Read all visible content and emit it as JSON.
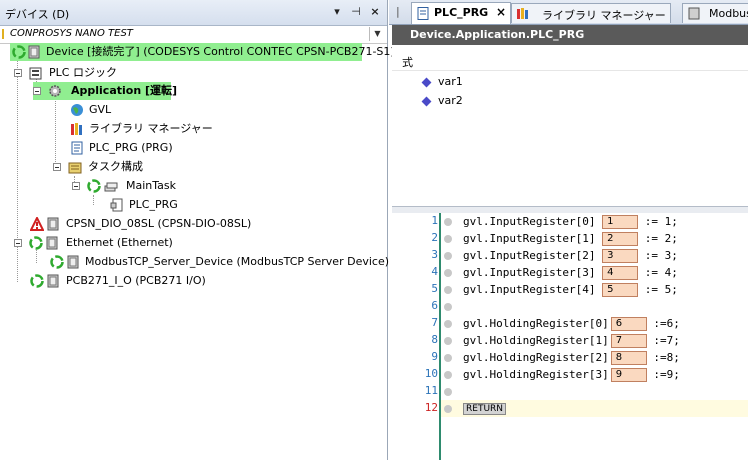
{
  "left_panel": {
    "title": "デバイス (D)",
    "header_buttons": {
      "dropdown": "▾",
      "pin": "⊣",
      "close": "×"
    },
    "project_selector": "CONPROSYS NANO TEST",
    "tree": [
      {
        "label": "Device [接続完了] (CODESYS Control CONTEC CPSN-PCB271-S1)",
        "highlight": true,
        "icon": "device-running-icon"
      },
      {
        "label": "PLC ロジック",
        "icon": "plc-logic-icon"
      },
      {
        "label": "Application [運転]",
        "highlight": true,
        "bold": true,
        "icon": "application-gear-icon"
      },
      {
        "label": "GVL",
        "icon": "globe-icon"
      },
      {
        "label": "ライブラリ マネージャー",
        "icon": "library-books-icon"
      },
      {
        "label": "PLC_PRG (PRG)",
        "icon": "program-document-icon"
      },
      {
        "label": "タスク構成",
        "icon": "task-configuration-icon"
      },
      {
        "label": "MainTask",
        "icon": "task-running-icon"
      },
      {
        "label": "PLC_PRG",
        "icon": "program-call-icon"
      },
      {
        "label": "CPSN_DIO_08SL (CPSN-DIO-08SL)",
        "icon": "warning-device-icon"
      },
      {
        "label": "Ethernet (Ethernet)",
        "icon": "ethernet-running-icon"
      },
      {
        "label": "ModbusTCP_Server_Device (ModbusTCP Server Device)",
        "icon": "modbus-device-running-icon"
      },
      {
        "label": "PCB271_I_O (PCB271 I/O)",
        "icon": "io-device-running-icon"
      }
    ]
  },
  "tabs": [
    {
      "label": "PLC_PRG",
      "active": true,
      "close": "×"
    },
    {
      "label": "ライブラリ マネージャー",
      "active": false
    },
    {
      "label": "Modbus",
      "active": false
    }
  ],
  "editor": {
    "title": "Device.Application.PLC_PRG",
    "declaration_label": "式",
    "variables": [
      "var1",
      "var2"
    ],
    "lines": [
      {
        "num": "1",
        "prefix": "gvl.InputRegister[0]",
        "value": "1",
        "suffix": " := 1;"
      },
      {
        "num": "2",
        "prefix": "gvl.InputRegister[1]",
        "value": "2",
        "suffix": " := 2;"
      },
      {
        "num": "3",
        "prefix": "gvl.InputRegister[2]",
        "value": "3",
        "suffix": " := 3;"
      },
      {
        "num": "4",
        "prefix": "gvl.InputRegister[3]",
        "value": "4",
        "suffix": " := 4;"
      },
      {
        "num": "5",
        "prefix": "gvl.InputRegister[4]",
        "value": "5",
        "suffix": " := 5;"
      },
      {
        "num": "6",
        "prefix": "",
        "value": "",
        "suffix": ""
      },
      {
        "num": "7",
        "prefix": "gvl.HoldingRegister[0]",
        "value": "6",
        "suffix": " :=6;"
      },
      {
        "num": "8",
        "prefix": "gvl.HoldingRegister[1]",
        "value": "7",
        "suffix": " :=7;"
      },
      {
        "num": "9",
        "prefix": "gvl.HoldingRegister[2]",
        "value": "8",
        "suffix": " :=8;"
      },
      {
        "num": "10",
        "prefix": "gvl.HoldingRegister[3]",
        "value": "9",
        "suffix": " :=9;"
      },
      {
        "num": "11",
        "prefix": "",
        "value": "",
        "suffix": ""
      },
      {
        "num": "12",
        "prefix": "",
        "value": "",
        "suffix": ""
      }
    ],
    "return_label": "RETURN"
  }
}
